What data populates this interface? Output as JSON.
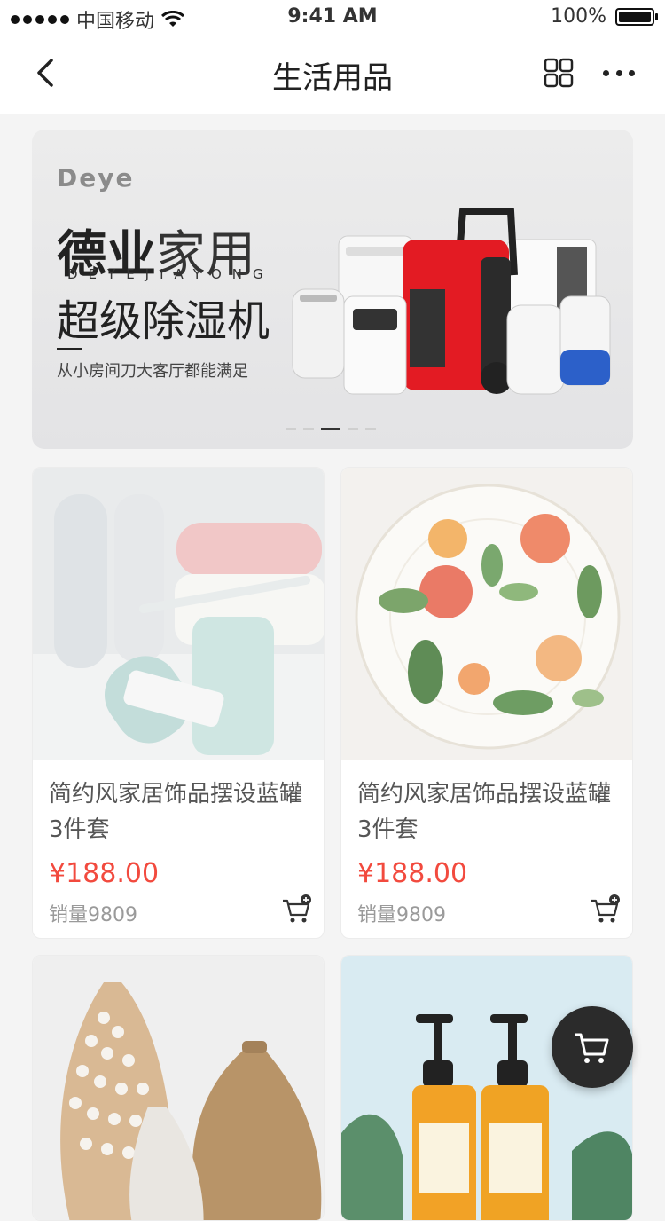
{
  "status_bar": {
    "carrier": "中国移动",
    "time": "9:41 AM",
    "battery": "100%"
  },
  "nav": {
    "title": "生活用品"
  },
  "banner": {
    "brand": "Deye",
    "headline_bold": "德业",
    "headline_light": "家用",
    "pinyin": "DEYEJIAYONG",
    "subtitle": "超级除湿机",
    "tagline": "从小房间刀大客厅都能满足",
    "active_slide": 3,
    "slide_count": 5
  },
  "products": [
    {
      "name": "简约风家居饰品摆设蓝罐3件套",
      "price": "¥188.00",
      "sales": "销量9809",
      "image": "toothbrush-cups-photo"
    },
    {
      "name": "简约风家居饰品摆设蓝罐3件套",
      "price": "¥188.00",
      "sales": "销量9809",
      "image": "floral-plate-photo"
    },
    {
      "name": "",
      "price": "",
      "sales": "",
      "image": "ceramic-vases-photo"
    },
    {
      "name": "",
      "price": "",
      "sales": "",
      "image": "orange-shampoo-photo"
    }
  ],
  "icons": {
    "back": "back-arrow-icon",
    "grid": "grid-icon",
    "more": "more-icon",
    "add_to_cart": "cart-add-icon",
    "floating_cart": "cart-icon"
  },
  "colors": {
    "price": "#f24a3e",
    "fab": "#2b2b2b"
  }
}
